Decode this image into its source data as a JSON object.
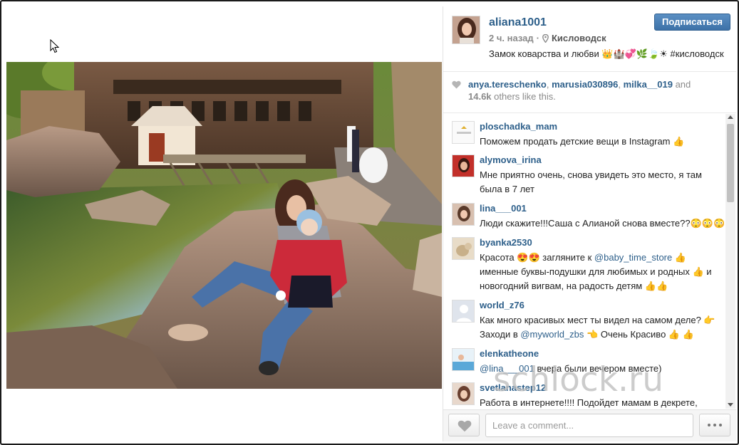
{
  "post": {
    "username": "aliana1001",
    "time_ago": "2 ч. назад",
    "separator": "·",
    "location": "Кисловодск",
    "caption": "Замок коварства и любви 👑🏰💞🌿🍃☀ #кисловодск",
    "follow_label": "Подписаться"
  },
  "likes": {
    "users": [
      "anya.tereschenko",
      "marusia030896",
      "milka__019"
    ],
    "sep1": ", ",
    "sep2": ", ",
    "and_text": " and",
    "others_count": "14.6k",
    "others_text": " others like this."
  },
  "comments": [
    {
      "user": "ploschadka_mam",
      "parts": [
        "Поможем продать детские вещи в Instagram 👍"
      ]
    },
    {
      "user": "alymova_irina",
      "parts": [
        "Мне приятно очень, снова увидеть это место, я там была в 7 лет"
      ]
    },
    {
      "user": "lina___001",
      "parts": [
        "Люди скажите!!!Саша с Алианой снова вместе??😳😳😳"
      ]
    },
    {
      "user": "byanka2530",
      "t1": "Красота 😍😍 загляните к ",
      "mention": "@baby_time_store",
      "t2": " 👍 именные буквы-подушки для любимых и родных 👍 и новогодний вигвам, на радость детям 👍👍"
    },
    {
      "user": "world_z76",
      "t1": "Как много красивых мест ты видел на самом деле? 👉Заходи в ",
      "mention": "@myworld_zbs",
      "t2": " 👈 Очень Красиво 👍 👍"
    },
    {
      "user": "elenkatheone",
      "t1": "",
      "mention": "@lina___001",
      "t2": " вчера были вечером вместе)"
    },
    {
      "user": "svetlanastep12",
      "parts": [
        "Работа в интернете!!!! Подойдет мамам в декрете,"
      ]
    }
  ],
  "comment_input": {
    "placeholder": "Leave a comment..."
  },
  "watermark": "schlock.ru",
  "colors": {
    "link": "#2d5f8a",
    "follow_button": "#3d72a8",
    "meta": "#8a8a8a"
  },
  "icons": [
    "cursor-icon",
    "location-pin-icon",
    "heart-icon",
    "more-options-icon"
  ]
}
